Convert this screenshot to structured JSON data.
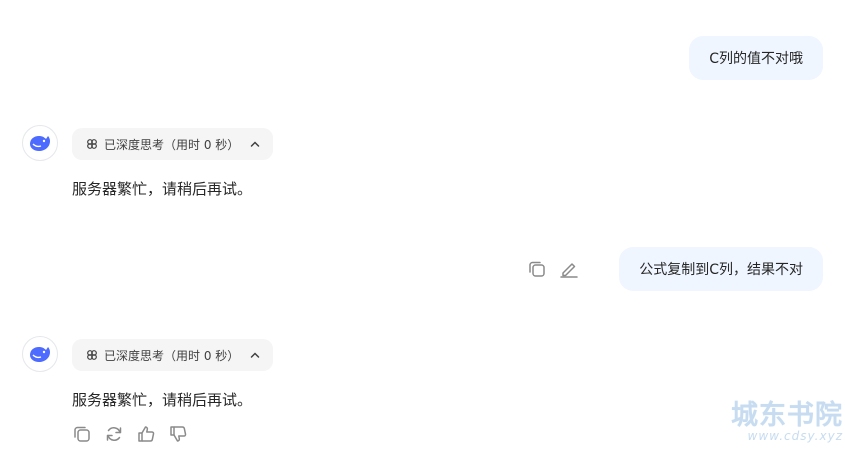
{
  "messages": [
    {
      "role": "user",
      "text": "C列的值不对哦"
    },
    {
      "role": "assistant",
      "thinking_label": "已深度思考（用时 0 秒）",
      "text": "服务器繁忙，请稍后再试。"
    },
    {
      "role": "user",
      "text": "公式复制到C列，结果不对"
    },
    {
      "role": "assistant",
      "thinking_label": "已深度思考（用时 0 秒）",
      "text": "服务器繁忙，请稍后再试。"
    }
  ],
  "user_actions": {
    "icons": [
      "copy-icon",
      "edit-icon"
    ]
  },
  "bot_actions": {
    "icons": [
      "copy-icon",
      "regenerate-icon",
      "thumbs-up-icon",
      "thumbs-down-icon"
    ]
  },
  "watermark": {
    "title": "城东书院",
    "url": "www.cdsy.xyz"
  },
  "colors": {
    "accent": "#4d6bfe",
    "user_bubble": "#eff6ff",
    "pill": "#f5f5f5"
  }
}
